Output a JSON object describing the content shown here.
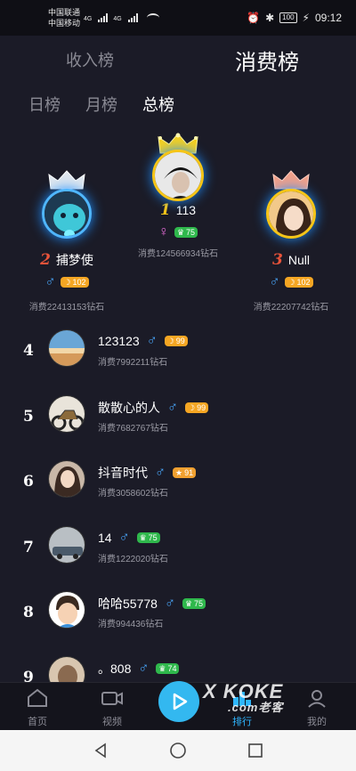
{
  "status_bar": {
    "carrier1": "中国联通",
    "carrier2": "中国移动",
    "net1": "4G",
    "net2": "4G",
    "battery": "100",
    "time": "09:12"
  },
  "top_tabs": {
    "income": "收入榜",
    "spending": "消费榜"
  },
  "period_tabs": [
    "日榜",
    "月榜",
    "总榜"
  ],
  "podium": {
    "first": {
      "rank": "1",
      "name": "113",
      "gender": "female",
      "gender_symbol": "♀",
      "level": "75",
      "level_color": "green",
      "spent": "消费124566934钻石"
    },
    "second": {
      "rank": "2",
      "name": "捕梦使",
      "gender": "male",
      "gender_symbol": "♂",
      "level": "102",
      "level_color": "orange",
      "spent": "消费22413153钻石"
    },
    "third": {
      "rank": "3",
      "name": "Null",
      "gender": "male",
      "gender_symbol": "♂",
      "level": "102",
      "level_color": "orange",
      "spent": "消费22207742钻石"
    }
  },
  "list": [
    {
      "rank": "4",
      "name": "123123",
      "gender_symbol": "♂",
      "level": "99",
      "level_color": "orange",
      "spent": "消费7992211钻石"
    },
    {
      "rank": "5",
      "name": "散散心的人",
      "gender_symbol": "♂",
      "level": "99",
      "level_color": "orange",
      "spent": "消费7682767钻石"
    },
    {
      "rank": "6",
      "name": "抖音时代",
      "gender_symbol": "♂",
      "level": "91",
      "level_color": "amber",
      "spent": "消费3058602钻石"
    },
    {
      "rank": "7",
      "name": "14",
      "gender_symbol": "♂",
      "level": "75",
      "level_color": "green",
      "spent": "消费1222020钻石"
    },
    {
      "rank": "8",
      "name": "哈哈55778",
      "gender_symbol": "♂",
      "level": "75",
      "level_color": "green",
      "spent": "消费994436钻石"
    },
    {
      "rank": "9",
      "name": "。808",
      "gender_symbol": "♂",
      "level": "74",
      "level_color": "green",
      "spent": ""
    }
  ],
  "bottom_nav": {
    "home": "首页",
    "video": "视频",
    "rank": "排行",
    "me": "我的"
  },
  "watermark": {
    "main": "X KOKE",
    "sub": ".com老客"
  },
  "colors": {
    "accent": "#2fb6ff",
    "background": "#1b1b27",
    "male": "#4aa9ff",
    "female": "#e36bd6"
  }
}
